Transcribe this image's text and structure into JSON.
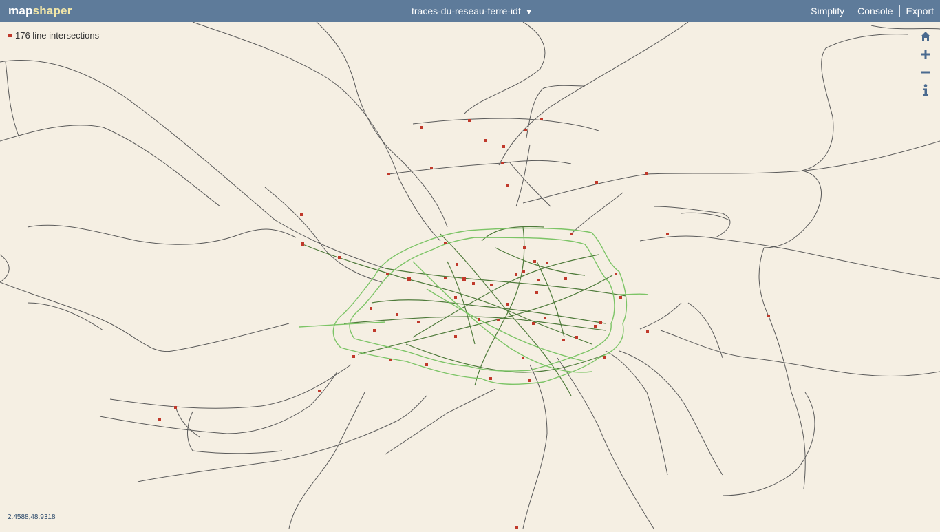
{
  "app": {
    "logo_part1": "map",
    "logo_part2": "shaper"
  },
  "layer_menu": {
    "name": "traces-du-reseau-ferre-idf",
    "arrow": "▼"
  },
  "menu": {
    "simplify": "Simplify",
    "console": "Console",
    "export": "Export"
  },
  "status": {
    "intersections": "176 line intersections"
  },
  "map_buttons": [
    {
      "icon": "home-icon"
    },
    {
      "icon": "zoom-in-icon"
    },
    {
      "icon": "zoom-out-icon"
    },
    {
      "icon": "info-icon"
    }
  ],
  "coords": "2.4588,48.9318",
  "colors": {
    "topbar": "#5e7b9a",
    "background": "#f5efe3",
    "line_dark": "#555555",
    "line_green_light": "#7cc466",
    "line_green_dark": "#4e7a3a",
    "intersection": "#c0392b",
    "button_icon": "#4a6a8f"
  }
}
